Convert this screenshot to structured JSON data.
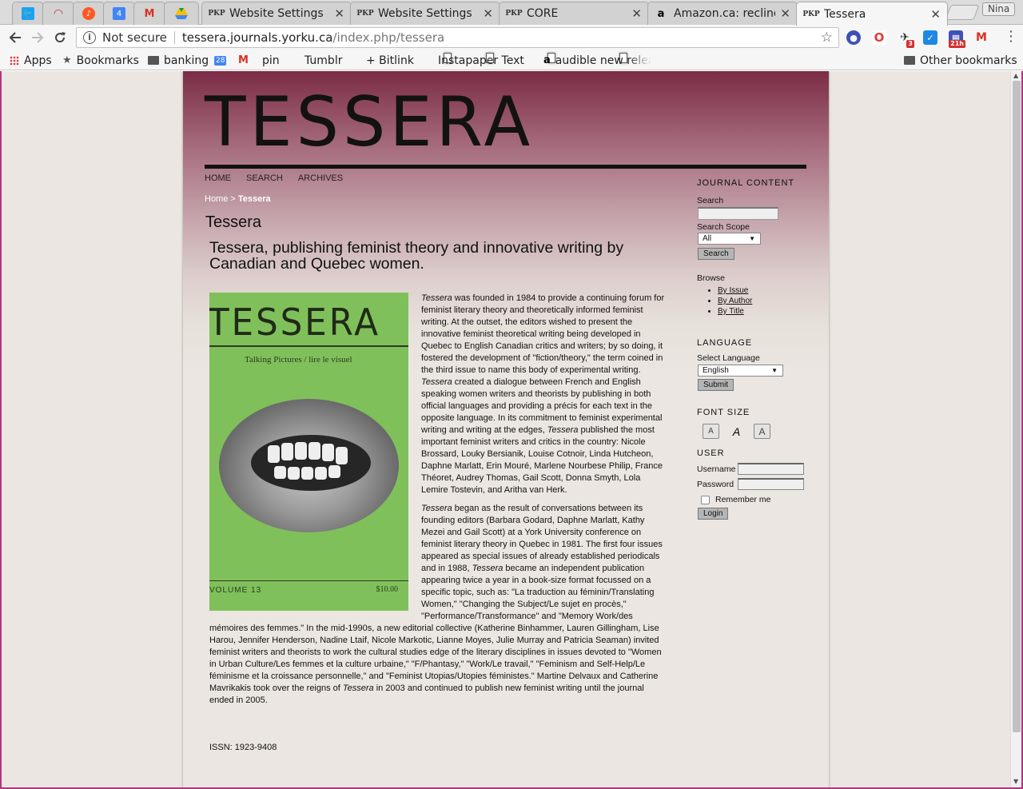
{
  "browser": {
    "tabs": [
      {
        "title": "",
        "icon": "twitter-icon",
        "pinned": true
      },
      {
        "title": "",
        "icon": "speedometer-icon",
        "pinned": true
      },
      {
        "title": "",
        "icon": "music-icon",
        "pinned": true
      },
      {
        "title": "",
        "icon": "calendar-icon",
        "pinned": true
      },
      {
        "title": "",
        "icon": "gmail-icon",
        "pinned": true
      },
      {
        "title": "",
        "icon": "drive-icon",
        "pinned": true
      },
      {
        "title": "Website Settings",
        "icon": "pkp-icon"
      },
      {
        "title": "Website Settings",
        "icon": "pkp-icon"
      },
      {
        "title": "CORE",
        "icon": "pkp-icon"
      },
      {
        "title": "Amazon.ca: recline",
        "icon": "amazon-icon"
      },
      {
        "title": "Tessera",
        "icon": "pkp-icon",
        "active": true
      }
    ],
    "pkp_label": "PKP",
    "calendar_day": "4",
    "profile_name": "Nina",
    "close_glyph": "✕",
    "security_text": "Not secure",
    "url_host": "tessera.journals.yorku.ca",
    "url_path": "/index.php/tessera",
    "extension_badges": {
      "feedly": "3",
      "calendar": "21h"
    },
    "bookmarks": [
      "Apps",
      "Bookmarks",
      "banking",
      "28",
      "pin",
      "Tumblr",
      "+ Bitlink",
      "Instapaper Text",
      "audible new relea",
      "Other bookmarks"
    ]
  },
  "site": {
    "logo": "TESSERA",
    "nav": [
      "HOME",
      "SEARCH",
      "ARCHIVES"
    ],
    "breadcrumb_home": "Home",
    "breadcrumb_sep": " > ",
    "breadcrumb_current": "Tessera",
    "page_title": "Tessera",
    "tagline": "Tessera, publishing feminist theory and innovative writing by Canadian and Quebec women."
  },
  "cover": {
    "title": "TESSERA",
    "subtitle": "Talking Pictures / lire le visuel",
    "volume": "VOLUME 13",
    "price": "$10.00"
  },
  "article": {
    "em_tessera": "Tessera",
    "p1_a": " was founded in 1984 to provide a continuing forum for feminist literary theory and theoretically informed feminist writing.  At the outset, the editors wished to present the innovative feminist theoretical writing being developed in Quebec to English Canadian critics and writers; by so doing, it fostered the development of \"fiction/theory,\" the term coined in the third issue to name this body of experimental writing. ",
    "p1_b": " created a dialogue between French and English speaking women writers and theorists by publishing in both official languages and providing a précis for each text in the opposite language. In its commitment to feminist experimental writing and writing at the edges, ",
    "p1_c": " published the most important feminist writers and critics in the country: Nicole Brossard, Louky Bersianik, Louise Cotnoir, Linda Hutcheon, Daphne Marlatt, Erin Mouré, Marlene Nourbese Philip, France Théoret, Audrey Thomas, Gail Scott, Donna Smyth, Lola Lemire Tostevin, and Aritha van Herk.",
    "p2_a": " began as the result of conversations between its founding editors (Barbara Godard, Daphne Marlatt, Kathy Mezei and Gail Scott) at a York University conference on feminist literary theory in Quebec in 1981. The first four issues appeared as special issues of already established periodicals and in 1988, ",
    "p2_b": " became an independent publication appearing twice a year in a book-size format focussed on a specific topic, such  as: \"La traduction au féminin/Translating Women,\" \"Changing the Subject/Le sujet en procès,\" \"Performance/Transformance\" and \"Memory Work/des mémoires des femmes.\"  In the mid-1990s, a new editorial collective (Katherine Binhammer, Lauren Gillingham, Lise Harou, Jennifer Henderson, Nadine Ltaif, Nicole Markotic, Lianne Moyes, Julie Murray and Patricia Seaman) invited feminist writers and theorists to work the cultural studies edge of the literary disciplines in issues devoted to \"Women in Urban Culture/Les femmes et la culture urbaine,\" \"F/Phantasy,\" \"Work/Le travail,\" \"Feminism and Self-Help/Le féminisme et la croissance personnelle,\" and \"Feminist Utopias/Utopies féministes.\"  Martine Delvaux and Catherine Mavrikakis took over the reigns of ",
    "p2_c": " in 2003 and continued to publish new feminist writing until the journal ended in 2005.",
    "issn": "ISSN: 1923-9408"
  },
  "sidebar": {
    "journal_content": "JOURNAL CONTENT",
    "search_label": "Search",
    "scope_label": "Search Scope",
    "scope_value": "All",
    "search_button": "Search",
    "browse_label": "Browse",
    "browse_links": [
      "By Issue",
      "By Author",
      "By Title"
    ],
    "language_title": "LANGUAGE",
    "select_language_label": "Select Language",
    "language_value": "English",
    "submit_button": "Submit",
    "font_size_title": "FONT SIZE",
    "user_title": "USER",
    "username_label": "Username",
    "password_label": "Password",
    "remember_label": "Remember me",
    "login_button": "Login"
  },
  "colors": {
    "header_top": "#7b2c45",
    "page_bg": "#ebe6e1",
    "cover_green": "#80c05a"
  }
}
